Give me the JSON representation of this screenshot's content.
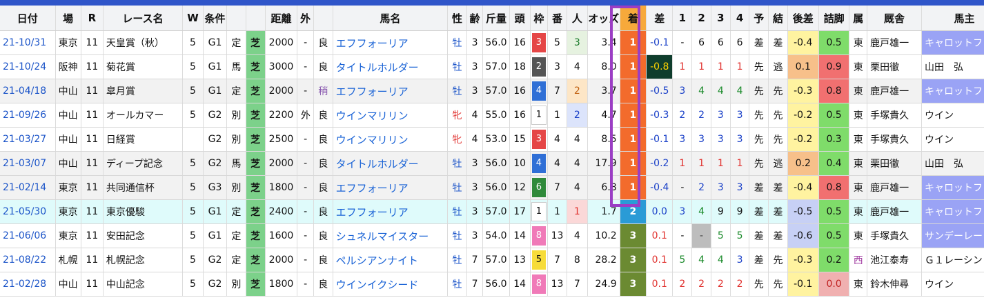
{
  "headers": [
    "日付",
    "場",
    "R",
    "レース名",
    "W",
    "条件",
    "",
    "",
    "距離",
    "外",
    "",
    "馬名",
    "性",
    "齢",
    "斤量",
    "頭",
    "枠",
    "番",
    "人",
    "オッズ",
    "着",
    "差",
    "1",
    "2",
    "3",
    "4",
    "予",
    "結",
    "後差",
    "詰脚",
    "属",
    "厩舎",
    "馬主"
  ],
  "rows": [
    {
      "date": "21-10/31",
      "place": "東京",
      "r": "11",
      "race": "天皇賞（秋）",
      "w": "5",
      "grade": "G1",
      "cond": "定",
      "surface": "芝",
      "dist": "2000",
      "out": "-",
      "going": "良",
      "horse": "エフフォーリア",
      "sex": "牡",
      "age": "3",
      "weight": "56.0",
      "heads": "16",
      "waku": "3",
      "ban": "5",
      "pop": "3",
      "odds": "3.4",
      "rank": "1",
      "diff": "-0.1",
      "p1": "-",
      "p2": "6",
      "p3": "6",
      "p4": "6",
      "yo": "差",
      "ke": "差",
      "ato": "-0.4",
      "tsume": "0.5",
      "belong": "東",
      "stable": "鹿戸雄一",
      "owner": "キャロットフ"
    },
    {
      "date": "21-10/24",
      "place": "阪神",
      "r": "11",
      "race": "菊花賞",
      "w": "5",
      "grade": "G1",
      "cond": "馬",
      "surface": "芝",
      "dist": "3000",
      "out": "-",
      "going": "良",
      "horse": "タイトルホルダー",
      "sex": "牡",
      "age": "3",
      "weight": "57.0",
      "heads": "18",
      "waku": "2",
      "ban": "3",
      "pop": "4",
      "odds": "8.0",
      "rank": "1",
      "diff": "-0.8",
      "p1": "1",
      "p2": "1",
      "p3": "1",
      "p4": "1",
      "yo": "先",
      "ke": "逃",
      "ato": "0.1",
      "tsume": "0.9",
      "belong": "東",
      "stable": "栗田徹",
      "owner": "山田　弘"
    },
    {
      "date": "21-04/18",
      "place": "中山",
      "r": "11",
      "race": "皐月賞",
      "w": "5",
      "grade": "G1",
      "cond": "定",
      "surface": "芝",
      "dist": "2000",
      "out": "-",
      "going": "稍",
      "horse": "エフフォーリア",
      "sex": "牡",
      "age": "3",
      "weight": "57.0",
      "heads": "16",
      "waku": "4",
      "ban": "7",
      "pop": "2",
      "odds": "3.7",
      "rank": "1",
      "diff": "-0.5",
      "p1": "3",
      "p2": "4",
      "p3": "4",
      "p4": "4",
      "yo": "先",
      "ke": "先",
      "ato": "-0.3",
      "tsume": "0.8",
      "belong": "東",
      "stable": "鹿戸雄一",
      "owner": "キャロットフ"
    },
    {
      "date": "21-09/26",
      "place": "中山",
      "r": "11",
      "race": "オールカマー",
      "w": "5",
      "grade": "G2",
      "cond": "別",
      "surface": "芝",
      "dist": "2200",
      "out": "外",
      "going": "良",
      "horse": "ウインマリリン",
      "sex": "牝",
      "age": "4",
      "weight": "55.0",
      "heads": "16",
      "waku": "1",
      "ban": "1",
      "pop": "2",
      "odds": "4.7",
      "rank": "1",
      "diff": "-0.3",
      "p1": "2",
      "p2": "2",
      "p3": "3",
      "p4": "3",
      "yo": "先",
      "ke": "先",
      "ato": "-0.2",
      "tsume": "0.5",
      "belong": "東",
      "stable": "手塚貴久",
      "owner": "ウイン"
    },
    {
      "date": "21-03/27",
      "place": "中山",
      "r": "11",
      "race": "日経賞",
      "w": "",
      "grade": "G2",
      "cond": "別",
      "surface": "芝",
      "dist": "2500",
      "out": "-",
      "going": "良",
      "horse": "ウインマリリン",
      "sex": "牝",
      "age": "4",
      "weight": "53.0",
      "heads": "15",
      "waku": "3",
      "ban": "4",
      "pop": "4",
      "odds": "8.5",
      "rank": "1",
      "diff": "-0.1",
      "p1": "3",
      "p2": "3",
      "p3": "3",
      "p4": "3",
      "yo": "先",
      "ke": "先",
      "ato": "-0.2",
      "tsume": "0.3",
      "belong": "東",
      "stable": "手塚貴久",
      "owner": "ウイン"
    },
    {
      "date": "21-03/07",
      "place": "中山",
      "r": "11",
      "race": "ディープ記念",
      "w": "5",
      "grade": "G2",
      "cond": "馬",
      "surface": "芝",
      "dist": "2000",
      "out": "-",
      "going": "良",
      "horse": "タイトルホルダー",
      "sex": "牡",
      "age": "3",
      "weight": "56.0",
      "heads": "10",
      "waku": "4",
      "ban": "4",
      "pop": "4",
      "odds": "17.9",
      "rank": "1",
      "diff": "-0.2",
      "p1": "1",
      "p2": "1",
      "p3": "1",
      "p4": "1",
      "yo": "先",
      "ke": "逃",
      "ato": "0.2",
      "tsume": "0.4",
      "belong": "東",
      "stable": "栗田徹",
      "owner": "山田　弘"
    },
    {
      "date": "21-02/14",
      "place": "東京",
      "r": "11",
      "race": "共同通信杯",
      "w": "5",
      "grade": "G3",
      "cond": "別",
      "surface": "芝",
      "dist": "1800",
      "out": "-",
      "going": "良",
      "horse": "エフフォーリア",
      "sex": "牡",
      "age": "3",
      "weight": "56.0",
      "heads": "12",
      "waku": "6",
      "ban": "7",
      "pop": "4",
      "odds": "6.8",
      "rank": "1",
      "diff": "-0.4",
      "p1": "-",
      "p2": "2",
      "p3": "3",
      "p4": "3",
      "yo": "差",
      "ke": "差",
      "ato": "-0.4",
      "tsume": "0.8",
      "belong": "東",
      "stable": "鹿戸雄一",
      "owner": "キャロットフ"
    },
    {
      "date": "21-05/30",
      "place": "東京",
      "r": "11",
      "race": "東京優駿",
      "w": "5",
      "grade": "G1",
      "cond": "定",
      "surface": "芝",
      "dist": "2400",
      "out": "-",
      "going": "良",
      "horse": "エフフォーリア",
      "sex": "牡",
      "age": "3",
      "weight": "57.0",
      "heads": "17",
      "waku": "1",
      "ban": "1",
      "pop": "1",
      "odds": "1.7",
      "rank": "2",
      "diff": "0.0",
      "p1": "3",
      "p2": "4",
      "p3": "9",
      "p4": "9",
      "yo": "差",
      "ke": "差",
      "ato": "-0.5",
      "tsume": "0.5",
      "belong": "東",
      "stable": "鹿戸雄一",
      "owner": "キャロットフ"
    },
    {
      "date": "21-06/06",
      "place": "東京",
      "r": "11",
      "race": "安田記念",
      "w": "5",
      "grade": "G1",
      "cond": "定",
      "surface": "芝",
      "dist": "1600",
      "out": "-",
      "going": "良",
      "horse": "シュネルマイスター",
      "sex": "牡",
      "age": "3",
      "weight": "54.0",
      "heads": "14",
      "waku": "8",
      "ban": "13",
      "pop": "4",
      "odds": "10.2",
      "rank": "3",
      "diff": "0.1",
      "p1": "-",
      "p2": "-",
      "p3": "5",
      "p4": "5",
      "yo": "差",
      "ke": "差",
      "ato": "-0.6",
      "tsume": "0.5",
      "belong": "東",
      "stable": "手塚貴久",
      "owner": "サンデーレー"
    },
    {
      "date": "21-08/22",
      "place": "札幌",
      "r": "11",
      "race": "札幌記念",
      "w": "5",
      "grade": "G2",
      "cond": "定",
      "surface": "芝",
      "dist": "2000",
      "out": "-",
      "going": "良",
      "horse": "ペルシアンナイト",
      "sex": "牡",
      "age": "7",
      "weight": "57.0",
      "heads": "13",
      "waku": "5",
      "ban": "7",
      "pop": "8",
      "odds": "28.2",
      "rank": "3",
      "diff": "0.1",
      "p1": "5",
      "p2": "4",
      "p3": "4",
      "p4": "3",
      "yo": "差",
      "ke": "先",
      "ato": "-0.3",
      "tsume": "0.2",
      "belong": "西",
      "stable": "池江泰寿",
      "owner": "Ｇ１レーシン"
    },
    {
      "date": "21-02/28",
      "place": "中山",
      "r": "11",
      "race": "中山記念",
      "w": "5",
      "grade": "G2",
      "cond": "別",
      "surface": "芝",
      "dist": "1800",
      "out": "-",
      "going": "良",
      "horse": "ウインイクシード",
      "sex": "牡",
      "age": "7",
      "weight": "56.0",
      "heads": "14",
      "waku": "8",
      "ban": "13",
      "pop": "7",
      "odds": "24.9",
      "rank": "3",
      "diff": "0.1",
      "p1": "2",
      "p2": "2",
      "p3": "2",
      "p4": "2",
      "yo": "先",
      "ke": "先",
      "ato": "-0.1",
      "tsume": "0.0",
      "belong": "東",
      "stable": "鈴木伸尋",
      "owner": "ウイン"
    }
  ]
}
